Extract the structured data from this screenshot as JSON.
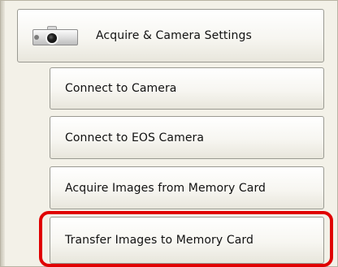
{
  "menu": {
    "main_item": {
      "label": "Acquire & Camera Settings",
      "icon": "camera-icon"
    },
    "sub_items": [
      {
        "label": "Connect to Camera"
      },
      {
        "label": "Connect to EOS Camera"
      },
      {
        "label": "Acquire Images from Memory Card"
      },
      {
        "label": "Transfer Images to Memory Card",
        "highlighted": true
      }
    ]
  },
  "colors": {
    "highlight": "#e00000",
    "panel_background": "#f3f1e8",
    "button_border": "#9a9a92"
  }
}
